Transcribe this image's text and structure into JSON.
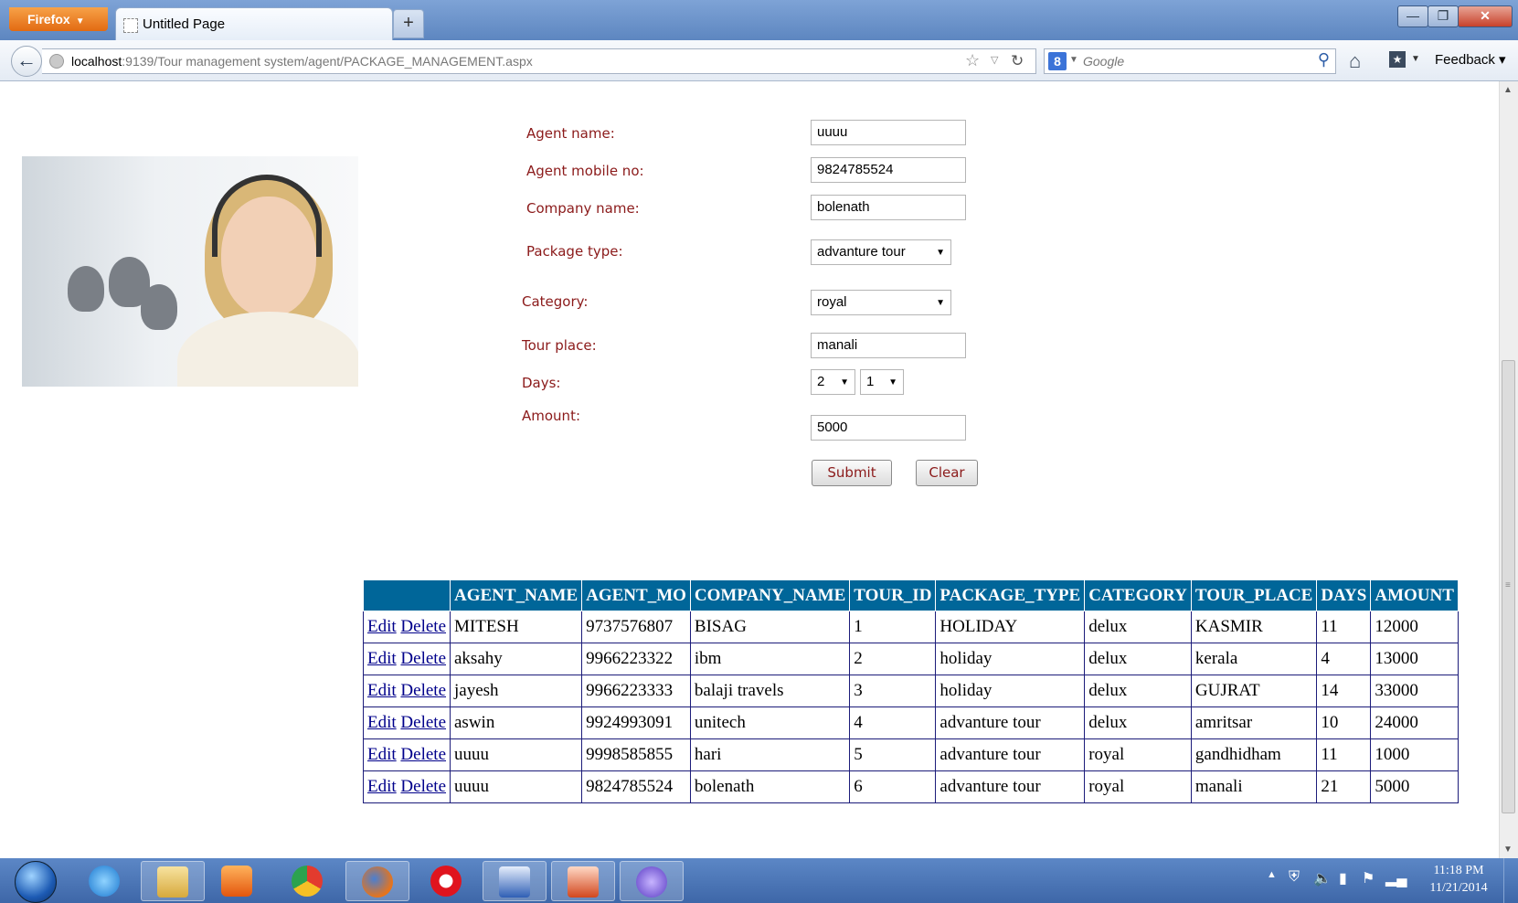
{
  "browser": {
    "app_button": "Firefox",
    "tab_title": "Untitled Page",
    "new_tab": "+",
    "url_host": "localhost",
    "url_rest": ":9139/Tour management system/agent/PACKAGE_MANAGEMENT.aspx",
    "search_placeholder": "Google",
    "feedback": "Feedback"
  },
  "form": {
    "agent_name_label": "Agent name:",
    "agent_name_value": "uuuu",
    "agent_mobile_label": "Agent mobile no:",
    "agent_mobile_value": "9824785524",
    "company_label": "Company name:",
    "company_value": "bolenath",
    "package_type_label": "Package type:",
    "package_type_value": "advanture tour",
    "category_label": "Category:",
    "category_value": "royal",
    "tour_place_label": "Tour place:",
    "tour_place_value": "manali",
    "days_label": "Days:",
    "days_value_1": "2",
    "days_value_2": "1",
    "amount_label": "Amount:",
    "amount_value": "5000",
    "submit_label": "Submit",
    "clear_label": "Clear"
  },
  "grid": {
    "headers": [
      "",
      "AGENT_NAME",
      "AGENT_MO",
      "COMPANY_NAME",
      "TOUR_ID",
      "PACKAGE_TYPE",
      "CATEGORY",
      "TOUR_PLACE",
      "DAYS",
      "AMOUNT"
    ],
    "edit_label": "Edit",
    "delete_label": "Delete",
    "rows": [
      [
        "MITESH",
        "9737576807",
        "BISAG",
        "1",
        "HOLIDAY",
        "delux",
        "KASMIR",
        "11",
        "12000"
      ],
      [
        "aksahy",
        "9966223322",
        "ibm",
        "2",
        "holiday",
        "delux",
        "kerala",
        "4",
        "13000"
      ],
      [
        "jayesh",
        "9966223333",
        "balaji travels",
        "3",
        "holiday",
        "delux",
        "GUJRAT",
        "14",
        "33000"
      ],
      [
        "aswin",
        "9924993091",
        "unitech",
        "4",
        "advanture tour",
        "delux",
        "amritsar",
        "10",
        "24000"
      ],
      [
        "uuuu",
        "9998585855",
        "hari",
        "5",
        "advanture tour",
        "royal",
        "gandhidham",
        "11",
        "1000"
      ],
      [
        "uuuu",
        "9824785524",
        "bolenath",
        "6",
        "advanture tour",
        "royal",
        "manali",
        "21",
        "5000"
      ]
    ]
  },
  "taskbar": {
    "time": "11:18 PM",
    "date": "11/21/2014"
  },
  "colors": {
    "grid_header": "#006699",
    "label": "#8b1a1a",
    "taskbar": "#4a74b5"
  },
  "icons": [
    "firefox-logo",
    "back-arrow",
    "globe",
    "star",
    "reload",
    "google",
    "search",
    "home",
    "bookmarks",
    "windows-start",
    "internet-explorer",
    "file-explorer",
    "media-player",
    "chrome",
    "firefox",
    "opera",
    "word",
    "powerpoint",
    "app"
  ]
}
